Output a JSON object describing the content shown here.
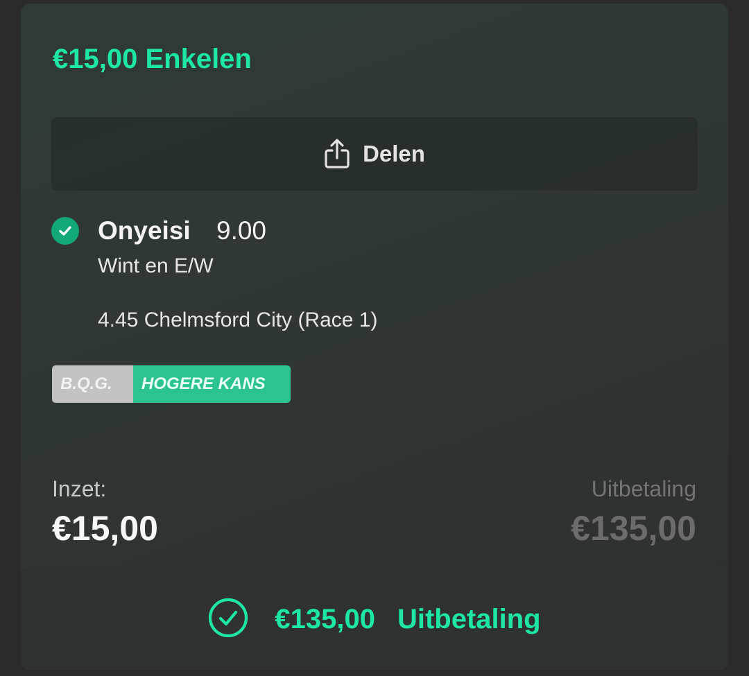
{
  "bet": {
    "title": "€15,00 Enkelen"
  },
  "share": {
    "label": "Delen",
    "icon": "share-icon"
  },
  "selection": {
    "name": "Onyeisi",
    "odds": "9.00",
    "market": "Wint en E/W",
    "event": "4.45 Chelmsford City (Race 1)",
    "status_icon": "check-circle-icon"
  },
  "badge": {
    "left": "B.Q.G.",
    "right": "HOGERE KANS"
  },
  "stake": {
    "label": "Inzet:",
    "value": "€15,00"
  },
  "payout": {
    "label": "Uitbetaling",
    "value": "€135,00"
  },
  "result": {
    "amount": "€135,00",
    "label": "Uitbetaling",
    "icon": "check-circle-outline-icon"
  },
  "colors": {
    "accent": "#1ee6a6",
    "badge_green": "#2bc491",
    "badge_grey": "#c2c2c2",
    "check_fill": "#12a879"
  }
}
